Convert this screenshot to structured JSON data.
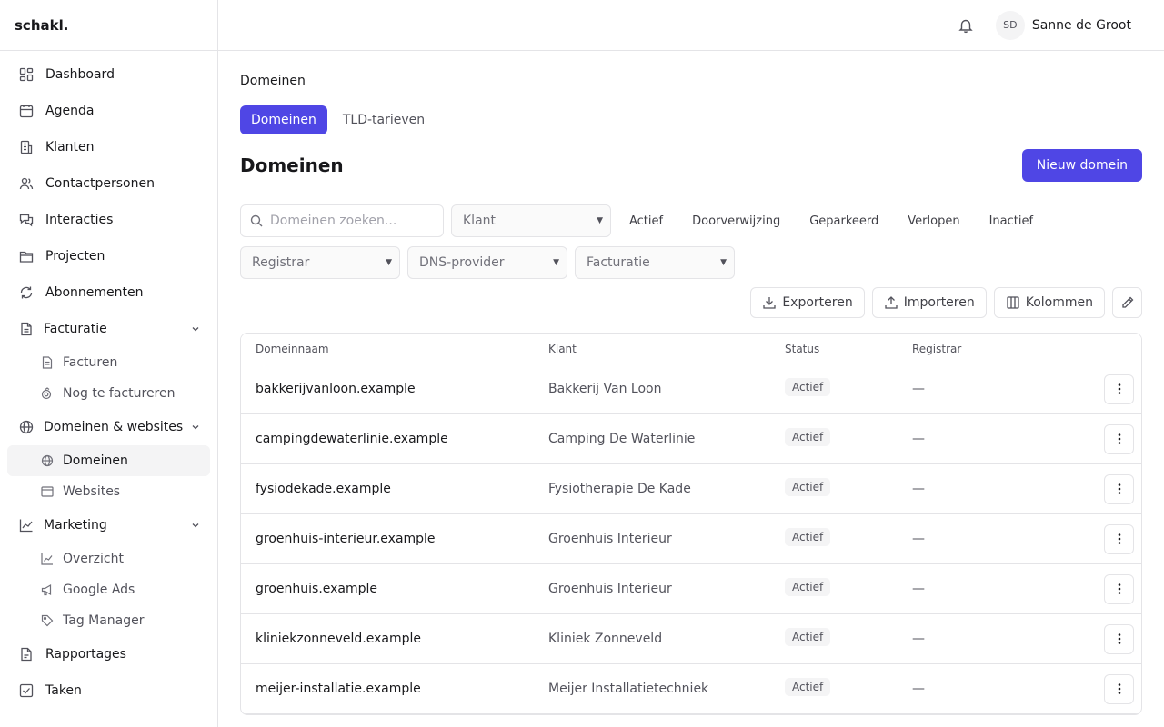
{
  "app": {
    "brand": "schakl."
  },
  "header": {
    "avatar_initials": "SD",
    "user_name": "Sanne de Groot"
  },
  "sidebar": {
    "items": [
      {
        "label": "Dashboard",
        "icon": "dashboard-icon"
      },
      {
        "label": "Agenda",
        "icon": "calendar-icon"
      },
      {
        "label": "Klanten",
        "icon": "building-icon"
      },
      {
        "label": "Contactpersonen",
        "icon": "users-icon"
      },
      {
        "label": "Interacties",
        "icon": "chat-icon"
      },
      {
        "label": "Projecten",
        "icon": "folder-icon"
      },
      {
        "label": "Abonnementen",
        "icon": "refresh-icon"
      }
    ],
    "facturatie": {
      "label": "Facturatie",
      "sub": [
        {
          "label": "Facturen"
        },
        {
          "label": "Nog te factureren"
        }
      ]
    },
    "domeinen": {
      "label": "Domeinen & websites",
      "sub": [
        {
          "label": "Domeinen"
        },
        {
          "label": "Websites"
        }
      ]
    },
    "marketing": {
      "label": "Marketing",
      "sub": [
        {
          "label": "Overzicht"
        },
        {
          "label": "Google Ads"
        },
        {
          "label": "Tag Manager"
        }
      ]
    },
    "bottom": [
      {
        "label": "Rapportages"
      },
      {
        "label": "Taken"
      }
    ]
  },
  "main": {
    "breadcrumb": "Domeinen",
    "tabs": [
      {
        "label": "Domeinen"
      },
      {
        "label": "TLD-tarieven"
      }
    ],
    "title": "Domeinen",
    "new_button": "Nieuw domein",
    "search_placeholder": "Domeinen zoeken...",
    "klant_select": "Klant",
    "status_chips": [
      "Actief",
      "Doorverwijzing",
      "Geparkeerd",
      "Verlopen",
      "Inactief"
    ],
    "registrar_select": "Registrar",
    "dns_select": "DNS-provider",
    "facturatie_select": "Facturatie",
    "actions": {
      "export": "Exporteren",
      "import": "Importeren",
      "columns": "Kolommen"
    }
  },
  "table": {
    "columns": [
      "Domeinnaam",
      "Klant",
      "Status",
      "Registrar"
    ],
    "rows": [
      {
        "domain": "bakkerijvanloon.example",
        "client": "Bakkerij Van Loon",
        "status": "Actief",
        "registrar": "—"
      },
      {
        "domain": "campingdewaterlinie.example",
        "client": "Camping De Waterlinie",
        "status": "Actief",
        "registrar": "—"
      },
      {
        "domain": "fysiodekade.example",
        "client": "Fysiotherapie De Kade",
        "status": "Actief",
        "registrar": "—"
      },
      {
        "domain": "groenhuis-interieur.example",
        "client": "Groenhuis Interieur",
        "status": "Actief",
        "registrar": "—"
      },
      {
        "domain": "groenhuis.example",
        "client": "Groenhuis Interieur",
        "status": "Actief",
        "registrar": "—"
      },
      {
        "domain": "kliniekzonneveld.example",
        "client": "Kliniek Zonneveld",
        "status": "Actief",
        "registrar": "—"
      },
      {
        "domain": "meijer-installatie.example",
        "client": "Meijer Installatietechniek",
        "status": "Actief",
        "registrar": "—"
      }
    ]
  },
  "colors": {
    "accent": "#4f46e5",
    "border": "#e4e4e7",
    "muted": "#52525b"
  }
}
